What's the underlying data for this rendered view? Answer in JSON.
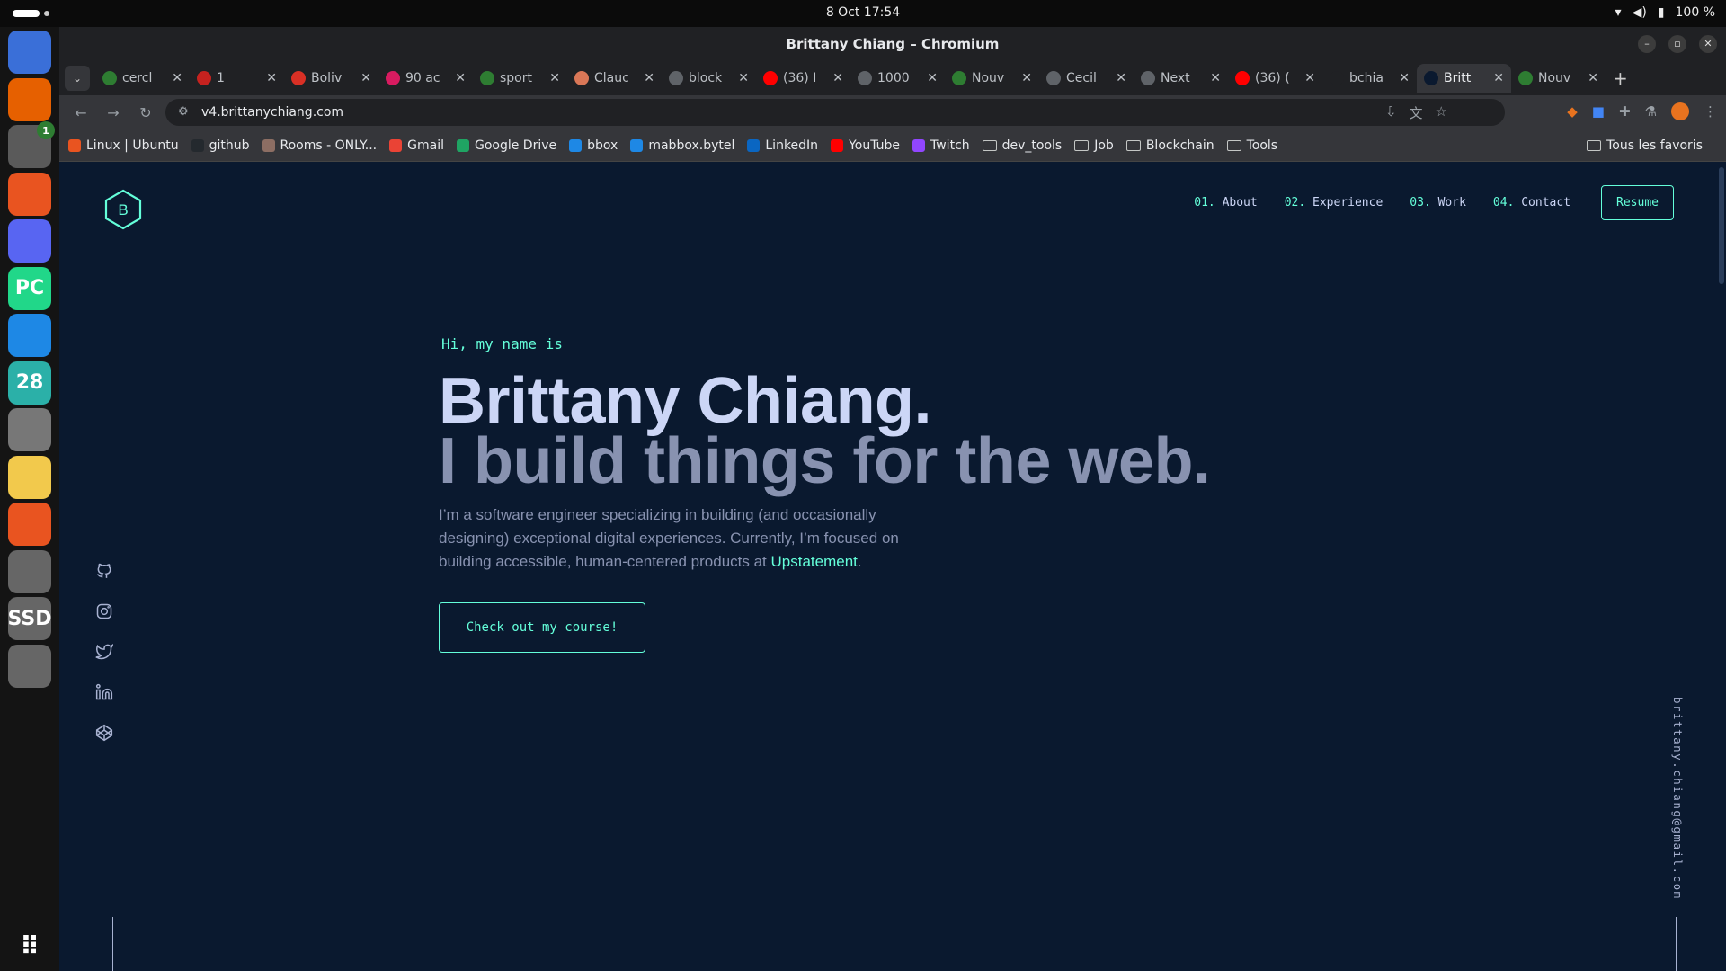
{
  "system": {
    "clock": "8 Oct  17:54",
    "battery": "100 %"
  },
  "dock": {
    "items": [
      {
        "name": "chromium-icon",
        "label": ""
      },
      {
        "name": "firefox-icon",
        "label": ""
      },
      {
        "name": "files-icon",
        "label": "",
        "badge": "1"
      },
      {
        "name": "app-center-icon",
        "label": ""
      },
      {
        "name": "discord-icon",
        "label": ""
      },
      {
        "name": "pycharm-icon",
        "label": "PC"
      },
      {
        "name": "vscode-icon",
        "label": ""
      },
      {
        "name": "calendar-icon",
        "label": "28"
      },
      {
        "name": "settings-icon",
        "label": ""
      },
      {
        "name": "text-editor-icon",
        "label": ""
      },
      {
        "name": "network-tool-icon",
        "label": ""
      },
      {
        "name": "disk-icon",
        "label": ""
      },
      {
        "name": "ssd-icon",
        "label": "SSD"
      },
      {
        "name": "trash-icon",
        "label": ""
      }
    ]
  },
  "window": {
    "title": "Brittany Chiang – Chromium"
  },
  "tabs": [
    {
      "title": "cercl",
      "color": "#2e7d32"
    },
    {
      "title": "1",
      "color": "#c5221f"
    },
    {
      "title": "Boliv",
      "color": "#d93025"
    },
    {
      "title": "90 ac",
      "color": "#d81b60"
    },
    {
      "title": "sport",
      "color": "#2e7d32"
    },
    {
      "title": "Clauc",
      "color": "#d97757"
    },
    {
      "title": "block",
      "color": "#5f6368"
    },
    {
      "title": "(36) I",
      "color": "#ff0000"
    },
    {
      "title": "1000",
      "color": "#5f6368"
    },
    {
      "title": "Nouv",
      "color": "#2e7d32"
    },
    {
      "title": "Cecil",
      "color": "#5f6368"
    },
    {
      "title": "Next",
      "color": "#5f6368"
    },
    {
      "title": "(36) (",
      "color": "#ff0000"
    },
    {
      "title": "bchia",
      "color": "#202124"
    },
    {
      "title": "Britt",
      "color": "#0a192f",
      "active": true
    },
    {
      "title": "Nouv",
      "color": "#2e7d32"
    }
  ],
  "address": {
    "url": "v4.brittanychiang.com"
  },
  "bookmarks": [
    {
      "label": "Linux | Ubuntu",
      "type": "icon",
      "color": "#e95420"
    },
    {
      "label": "github",
      "type": "icon",
      "color": "#24292e"
    },
    {
      "label": "Rooms - ONLY...",
      "type": "icon",
      "color": "#8d6e63"
    },
    {
      "label": "Gmail",
      "type": "icon",
      "color": "#ea4335"
    },
    {
      "label": "Google Drive",
      "type": "icon",
      "color": "#1fa463"
    },
    {
      "label": "bbox",
      "type": "icon",
      "color": "#1e88e5"
    },
    {
      "label": "mabbox.bytel",
      "type": "icon",
      "color": "#1e88e5"
    },
    {
      "label": "LinkedIn",
      "type": "icon",
      "color": "#0a66c2"
    },
    {
      "label": "YouTube",
      "type": "icon",
      "color": "#ff0000"
    },
    {
      "label": "Twitch",
      "type": "icon",
      "color": "#9146ff"
    },
    {
      "label": "dev_tools",
      "type": "folder"
    },
    {
      "label": "Job",
      "type": "folder"
    },
    {
      "label": "Blockchain",
      "type": "folder"
    },
    {
      "label": "Tools",
      "type": "folder"
    }
  ],
  "bookmarks_all": "Tous les favoris",
  "page": {
    "logo_letter": "B",
    "nav": [
      {
        "num": "01.",
        "label": "About"
      },
      {
        "num": "02.",
        "label": "Experience"
      },
      {
        "num": "03.",
        "label": "Work"
      },
      {
        "num": "04.",
        "label": "Contact"
      }
    ],
    "resume_label": "Resume",
    "greeting": "Hi, my name is",
    "name": "Brittany Chiang.",
    "tagline": "I build things for the web.",
    "bio_before": "I’m a software engineer specializing in building (and occasionally designing) exceptional digital experiences. Currently, I’m focused on building accessible, human-centered products at ",
    "bio_link": "Upstatement",
    "bio_after": ".",
    "cta_label": "Check out my course!",
    "email": "brittany.chiang@gmail.com",
    "colors": {
      "background": "#0a192f",
      "accent": "#64ffda",
      "heading": "#ccd6f6",
      "muted": "#8892b0"
    }
  }
}
